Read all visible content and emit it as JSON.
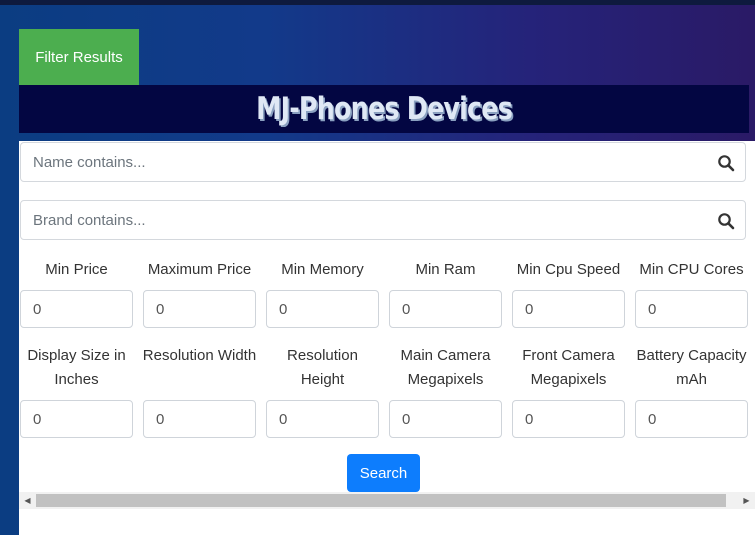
{
  "filter_button": "Filter Results",
  "title": "MJ-Phones Devices",
  "name_search": {
    "placeholder": "Name contains..."
  },
  "brand_search": {
    "placeholder": "Brand contains..."
  },
  "row1": [
    {
      "label": "Min Price",
      "value": "0"
    },
    {
      "label": "Maximum Price",
      "value": "0"
    },
    {
      "label": "Min Memory",
      "value": "0"
    },
    {
      "label": "Min Ram",
      "value": "0"
    },
    {
      "label": "Min Cpu Speed",
      "value": "0"
    },
    {
      "label": "Min CPU Cores",
      "value": "0"
    }
  ],
  "row2": [
    {
      "label": "Display Size in Inches",
      "value": "0"
    },
    {
      "label": "Resolution Width",
      "value": "0"
    },
    {
      "label": "Resolution Height",
      "value": "0"
    },
    {
      "label": "Main Camera Megapixels",
      "value": "0"
    },
    {
      "label": "Front Camera Megapixels",
      "value": "0"
    },
    {
      "label": "Battery Capacity mAh",
      "value": "0"
    }
  ],
  "search_button": "Search",
  "colors": {
    "filter": "#4cae4f",
    "title_bg": "#030642",
    "search": "#0d7dfd"
  }
}
